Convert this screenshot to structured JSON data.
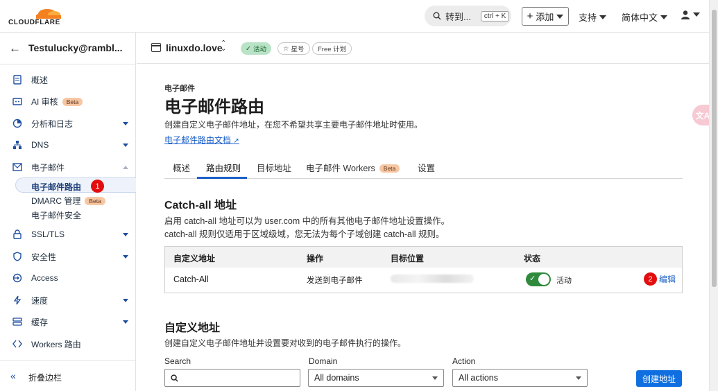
{
  "brand": {
    "logo_text": "CLOUDFLARE",
    "orange": "#f48120"
  },
  "topbar": {
    "search_label": "转到...",
    "shortcut": "ctrl + K",
    "add_label": "添加",
    "support_label": "支持",
    "language_label": "简体中文"
  },
  "sidebar": {
    "account_name": "Testulucky@rambl...",
    "items": [
      {
        "label": "概述",
        "icon": "document-icon"
      },
      {
        "label": "AI 审核",
        "icon": "ai-audit-icon",
        "badge": "Beta"
      },
      {
        "label": "分析和日志",
        "icon": "analytics-icon"
      },
      {
        "label": "DNS",
        "icon": "dns-icon"
      },
      {
        "label": "电子邮件",
        "icon": "mail-icon"
      },
      {
        "label": "SSL/TLS",
        "icon": "lock-icon"
      },
      {
        "label": "安全性",
        "icon": "shield-icon"
      },
      {
        "label": "Access",
        "icon": "access-icon"
      },
      {
        "label": "速度",
        "icon": "bolt-icon"
      },
      {
        "label": "缓存",
        "icon": "cache-icon"
      },
      {
        "label": "Workers 路由",
        "icon": "workers-icon"
      }
    ],
    "email_sub": [
      {
        "label": "电子邮件路由",
        "marker": "1"
      },
      {
        "label": "DMARC 管理",
        "badge": "Beta"
      },
      {
        "label": "电子邮件安全"
      }
    ],
    "collapse_label": "折叠边栏"
  },
  "zone": {
    "name": "linuxdo.love",
    "status": "活动",
    "star": "星号",
    "plan": "Free 计划"
  },
  "page": {
    "eyebrow": "电子邮件",
    "title": "电子邮件路由",
    "description": "创建自定义电子邮件地址，在您不希望共享主要电子邮件地址时使用。",
    "doc_link": "电子邮件路由文档",
    "tabs": [
      {
        "label": "概述"
      },
      {
        "label": "路由规则",
        "active": true
      },
      {
        "label": "目标地址"
      },
      {
        "label": "电子邮件 Workers",
        "badge": "Beta"
      },
      {
        "label": "设置"
      }
    ]
  },
  "catchall": {
    "title": "Catch-all 地址",
    "desc1": "启用 catch-all 地址可以为 user.com 中的所有其他电子邮件地址设置操作。",
    "desc2": "catch-all 规则仅适用于区域级域，您无法为每个子域创建 catch-all 规则。",
    "columns": [
      "自定义地址",
      "操作",
      "目标位置",
      "状态"
    ],
    "row": {
      "address": "Catch-All",
      "action": "发送到电子邮件",
      "destination": "",
      "status": "活动",
      "enabled": true,
      "edit": "编辑",
      "marker": "2"
    }
  },
  "custom": {
    "title": "自定义地址",
    "desc": "创建自定义电子邮件地址并设置要对收到的电子邮件执行的操作。",
    "search_label": "Search",
    "search_value": "",
    "domain_label": "Domain",
    "domain_value": "All domains",
    "action_label": "Action",
    "action_value": "All actions",
    "create_label": "创建地址"
  },
  "translate_icon_text": "文A"
}
